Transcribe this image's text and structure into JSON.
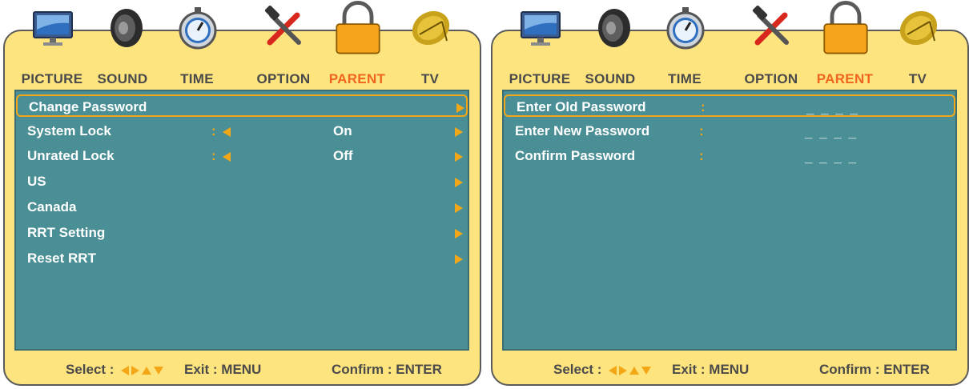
{
  "tabs": [
    {
      "label": "PICTURE",
      "icon": "monitor-icon"
    },
    {
      "label": "SOUND",
      "icon": "speaker-icon"
    },
    {
      "label": "TIME",
      "icon": "stopwatch-icon"
    },
    {
      "label": "OPTION",
      "icon": "tools-icon"
    },
    {
      "label": "PARENT",
      "icon": "lock-icon"
    },
    {
      "label": "TV",
      "icon": "satellite-dish-icon"
    }
  ],
  "active_tab": "PARENT",
  "left_menu": {
    "rows": [
      {
        "label": "Change Password",
        "value": "",
        "has_left_arrow": false,
        "has_right_arrow": true
      },
      {
        "label": "System Lock",
        "colon": ":",
        "value": "On",
        "has_left_arrow": true,
        "has_right_arrow": true
      },
      {
        "label": "Unrated Lock",
        "colon": ":",
        "value": "Off",
        "has_left_arrow": true,
        "has_right_arrow": true
      },
      {
        "label": "US",
        "value": "",
        "has_left_arrow": false,
        "has_right_arrow": true
      },
      {
        "label": "Canada",
        "value": "",
        "has_left_arrow": false,
        "has_right_arrow": true
      },
      {
        "label": "RRT Setting",
        "value": "",
        "has_left_arrow": false,
        "has_right_arrow": true
      },
      {
        "label": "Reset RRT",
        "value": "",
        "has_left_arrow": false,
        "has_right_arrow": true
      }
    ]
  },
  "right_menu": {
    "rows": [
      {
        "label": "Enter Old Password",
        "colon": ":",
        "value": "_ _ _ _"
      },
      {
        "label": "Enter New Password",
        "colon": ":",
        "value": "_ _ _ _"
      },
      {
        "label": "Confirm Password",
        "colon": ":",
        "value": "_ _ _ _"
      }
    ]
  },
  "footer": {
    "select": "Select :",
    "exit": "Exit : MENU",
    "confirm": "Confirm : ENTER"
  },
  "colors": {
    "frame": "#fee47f",
    "screen": "#4a8f95",
    "accent": "#f3a716",
    "active_tab": "#f0651e",
    "label": "#4a4a4a"
  }
}
